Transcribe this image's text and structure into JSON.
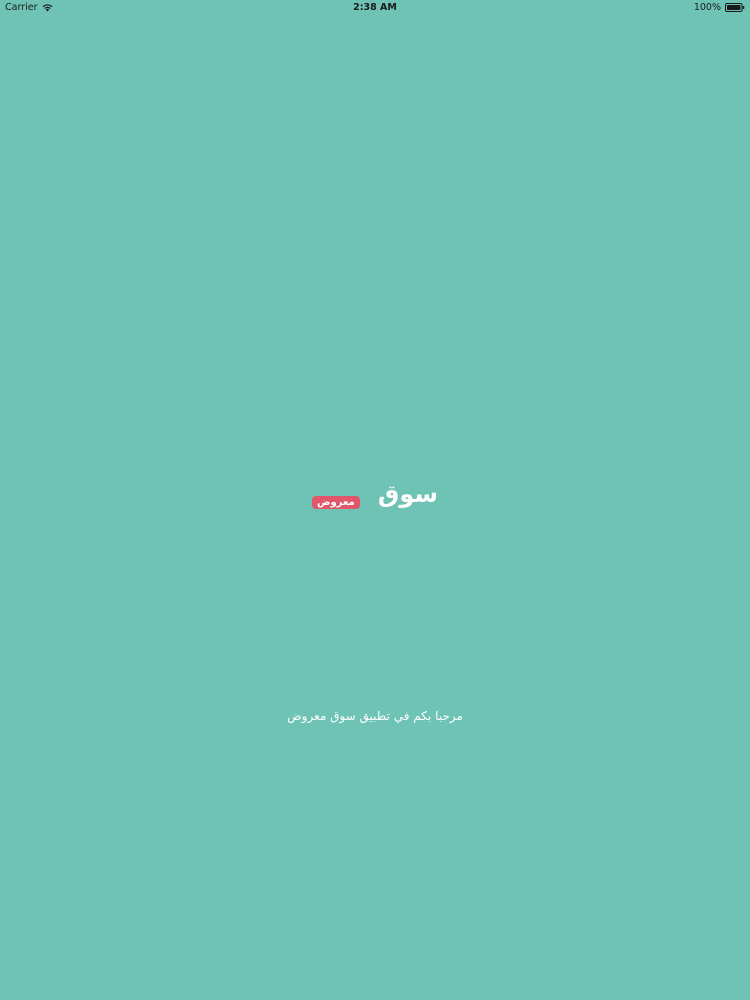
{
  "status_bar": {
    "carrier": "Carrier",
    "time": "2:38 AM",
    "battery_percent": "100%",
    "wifi_icon": "wifi-icon",
    "battery_icon": "battery-icon"
  },
  "splash": {
    "background_color": "#6ec3b4",
    "logo": {
      "main_text": "سوق",
      "badge_text": "معروض",
      "badge_color": "#e2566a"
    },
    "welcome_message": "مرحبا بكم في تطبيق سوق معروض"
  }
}
